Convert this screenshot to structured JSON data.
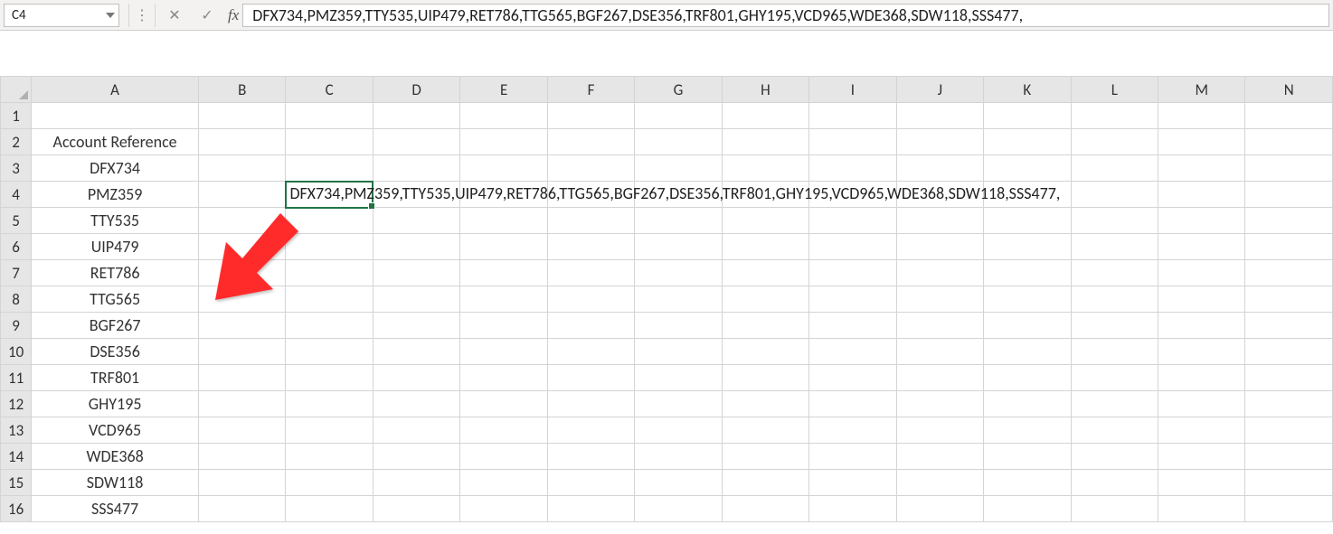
{
  "formula_bar": {
    "cell_ref": "C4",
    "fx_label": "fx",
    "formula_text": "DFX734,PMZ359,TTY535,UIP479,RET786,TTG565,BGF267,DSE356,TRF801,GHY195,VCD965,WDE368,SDW118,SSS477,"
  },
  "columns": [
    "A",
    "B",
    "C",
    "D",
    "E",
    "F",
    "G",
    "H",
    "I",
    "J",
    "K",
    "L",
    "M",
    "N"
  ],
  "rows": [
    "1",
    "2",
    "3",
    "4",
    "5",
    "6",
    "7",
    "8",
    "9",
    "10",
    "11",
    "12",
    "13",
    "14",
    "15",
    "16"
  ],
  "colA": {
    "header": "Account Reference",
    "values": [
      "DFX734",
      "PMZ359",
      "TTY535",
      "UIP479",
      "RET786",
      "TTG565",
      "BGF267",
      "DSE356",
      "TRF801",
      "GHY195",
      "VCD965",
      "WDE368",
      "SDW118",
      "SSS477"
    ]
  },
  "selected_cell": {
    "address": "C4",
    "display_text": "DFX734,PMZ359,TTY535,UIP479,RET786,TTG565,BGF267,DSE356,TRF801,GHY195,VCD965,WDE368,SDW118,SSS477,"
  },
  "icons": {
    "dropdown": "▾",
    "ellipsis": "⋮",
    "cancel": "✕",
    "enter": "✓"
  }
}
